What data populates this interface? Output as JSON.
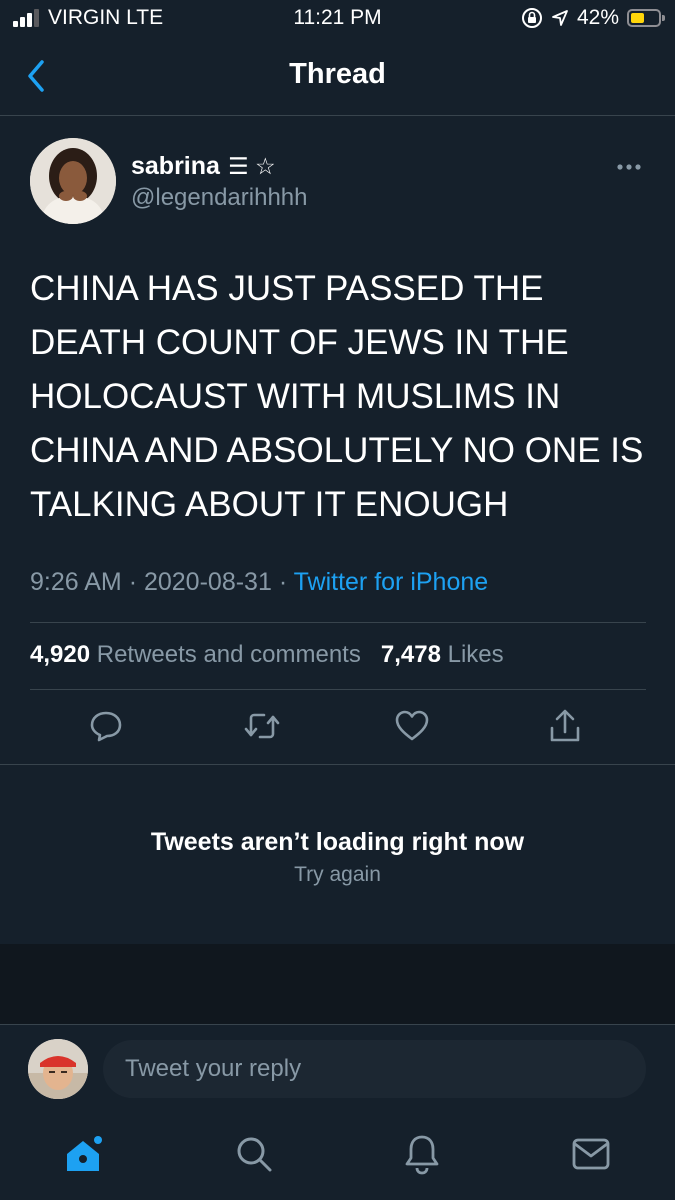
{
  "status_bar": {
    "carrier": "VIRGIN  LTE",
    "time": "11:21 PM",
    "battery_percent": "42%",
    "battery_level": 0.42,
    "icons": [
      "signal-icon",
      "screen-lock-icon",
      "location-icon",
      "battery-icon"
    ]
  },
  "nav": {
    "title": "Thread",
    "back_icon": "chevron-left-icon"
  },
  "tweet": {
    "author_name": "sabrina",
    "author_decorations": "☰ ☆",
    "handle": "@legendarihhhh",
    "text": "CHINA HAS JUST PASSED THE DEATH COUNT OF JEWS IN THE HOLOCAUST WITH MUSLIMS IN CHINA AND ABSOLUTELY NO ONE IS TALKING ABOUT IT ENOUGH",
    "time": "9:26 AM",
    "date": "2020-08-31",
    "separator": "·",
    "source": "Twitter for iPhone",
    "retweets_count": "4,920",
    "retweets_label": "Retweets and comments",
    "likes_count": "7,478",
    "likes_label": "Likes"
  },
  "actions": [
    "reply-icon",
    "retweet-icon",
    "like-icon",
    "share-icon"
  ],
  "error": {
    "title": "Tweets aren’t loading right now",
    "retry": "Try again"
  },
  "reply": {
    "placeholder": "Tweet your reply"
  },
  "tabs": [
    "home-icon",
    "search-icon",
    "notifications-icon",
    "messages-icon"
  ],
  "colors": {
    "background": "#15202b",
    "accent": "#1da1f2",
    "secondary_text": "#8899a6",
    "divider": "#38444d"
  }
}
